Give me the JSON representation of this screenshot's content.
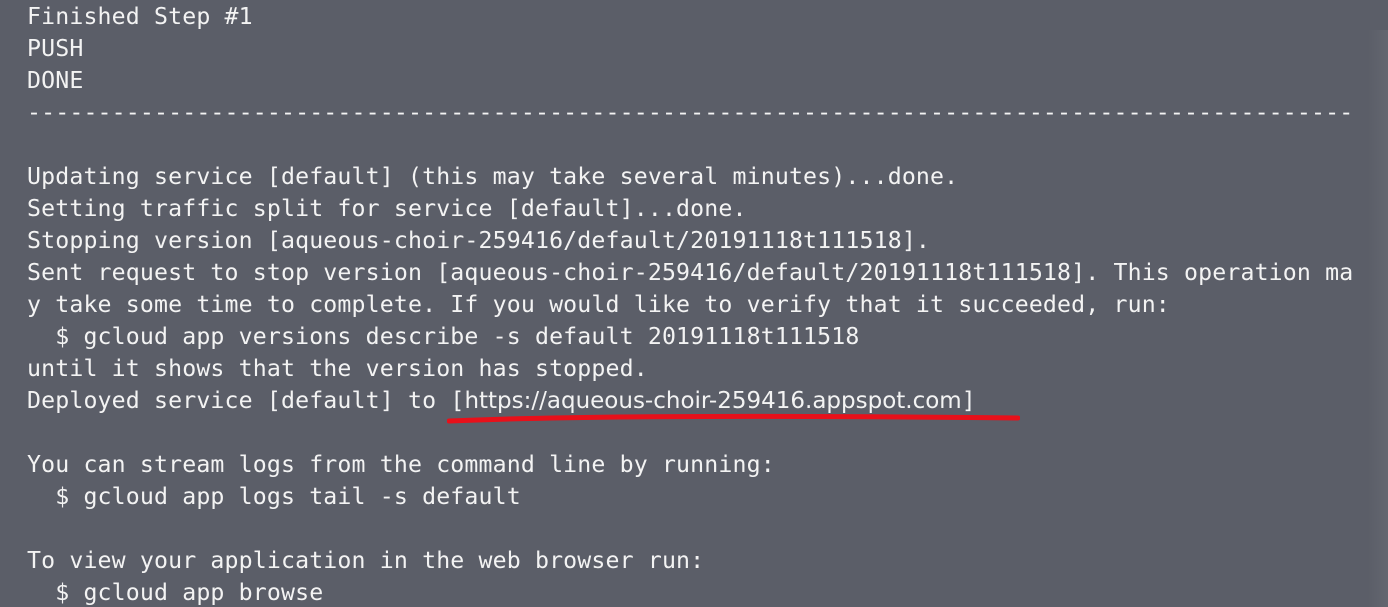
{
  "terminal": {
    "lines": [
      "Finished Step #1",
      "PUSH",
      "DONE",
      "----------------------------------------------------------------------------------------------",
      "",
      "Updating service [default] (this may take several minutes)...done.",
      "Setting traffic split for service [default]...done.",
      "Stopping version [aqueous-choir-259416/default/20191118t111518].",
      "Sent request to stop version [aqueous-choir-259416/default/20191118t111518]. This operation ma",
      "y take some time to complete. If you would like to verify that it succeeded, run:",
      "  $ gcloud app versions describe -s default 20191118t111518",
      "until it shows that the version has stopped.",
      "",
      "",
      "You can stream logs from the command line by running:",
      "  $ gcloud app logs tail -s default",
      "",
      "To view your application in the web browser run:",
      "  $ gcloud app browse"
    ],
    "deployed_prefix": "Deployed service [default] to ",
    "deployed_url_open": "[",
    "deployed_url": "https://aqueous-choir-259416.appspot.com",
    "deployed_url_close": "]",
    "annotation_color": "#e8101a"
  }
}
